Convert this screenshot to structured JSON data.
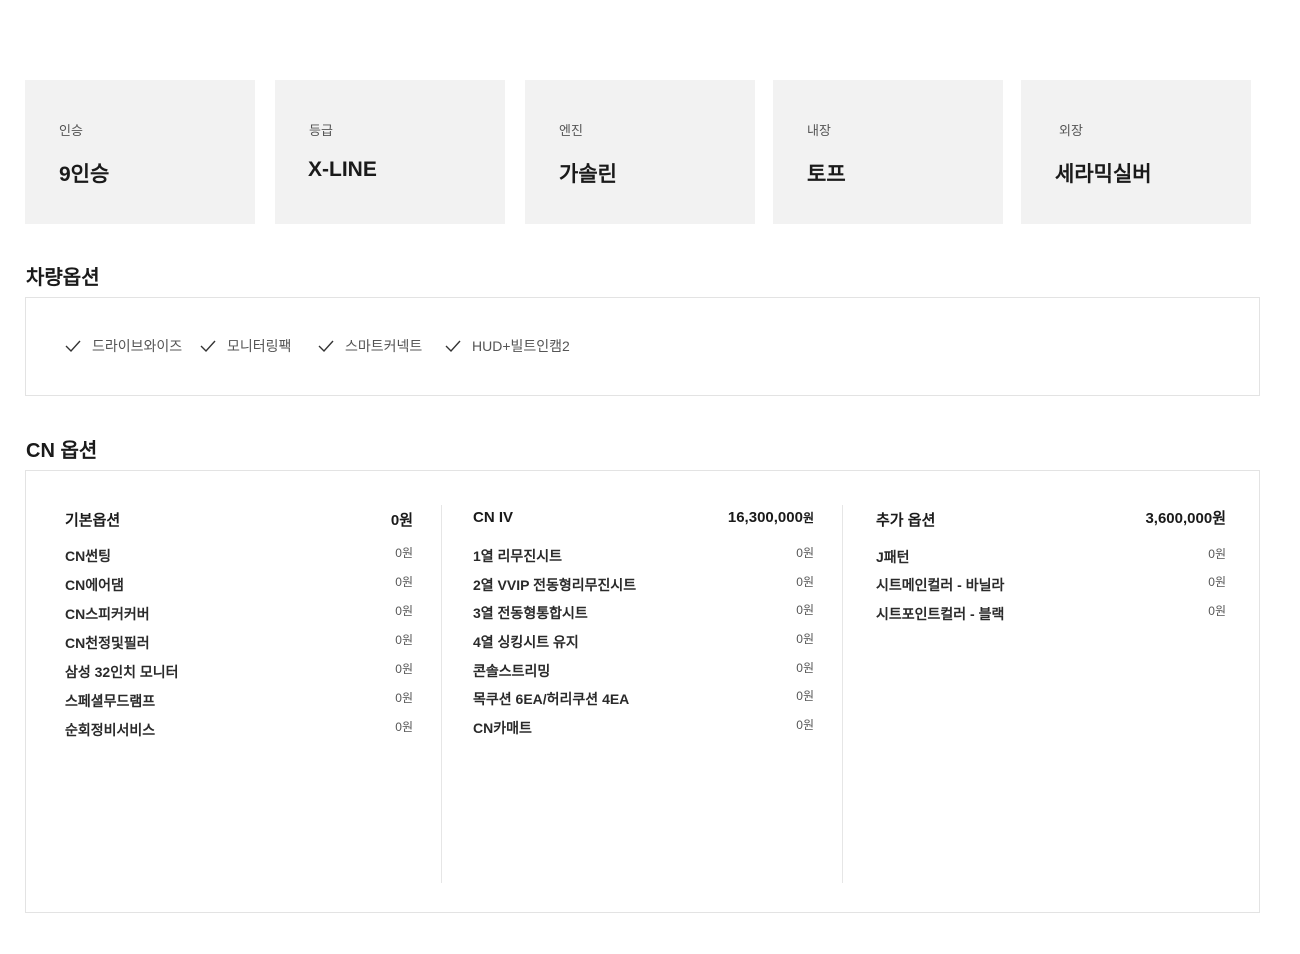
{
  "specs": [
    {
      "label": "인승",
      "value": "9인승"
    },
    {
      "label": "등급",
      "value": "X-LINE"
    },
    {
      "label": "엔진",
      "value": "가솔린"
    },
    {
      "label": "내장",
      "value": "토프"
    },
    {
      "label": "외장",
      "value": "세라믹실버"
    }
  ],
  "vehicle_options": {
    "title": "차량옵션",
    "items": [
      "드라이브와이즈",
      "모니터링팩",
      "스마트커넥트",
      "HUD+빌트인캠2"
    ]
  },
  "cn_options": {
    "title": "CN 옵션",
    "columns": [
      {
        "name": "기본옵션",
        "price": "0",
        "currency": "원",
        "rows": [
          {
            "name": "CN썬팅",
            "price": "0원"
          },
          {
            "name": "CN에어댐",
            "price": "0원"
          },
          {
            "name": "CN스피커커버",
            "price": "0원"
          },
          {
            "name": "CN천정및필러",
            "price": "0원"
          },
          {
            "name": "삼성 32인치 모니터",
            "price": "0원"
          },
          {
            "name": "스페셜무드램프",
            "price": "0원"
          },
          {
            "name": "순회정비서비스",
            "price": "0원"
          }
        ]
      },
      {
        "name": "CN IV",
        "price": "16,300,000",
        "currency": "원",
        "rows": [
          {
            "name": "1열 리무진시트",
            "price": "0원"
          },
          {
            "name": "2열 VVIP 전동형리무진시트",
            "price": "0원"
          },
          {
            "name": "3열 전동형통합시트",
            "price": "0원"
          },
          {
            "name": "4열 싱킹시트 유지",
            "price": "0원"
          },
          {
            "name": "콘솔스트리밍",
            "price": "0원"
          },
          {
            "name": "목쿠션 6EA/허리쿠션 4EA",
            "price": "0원"
          },
          {
            "name": "CN카매트",
            "price": "0원"
          }
        ]
      },
      {
        "name": "추가 옵션",
        "price": "3,600,000",
        "currency": "원",
        "rows": [
          {
            "name": "J패턴",
            "price": "0원"
          },
          {
            "name": "시트메인컬러 - 바닐라",
            "price": "0원"
          },
          {
            "name": "시트포인트컬러 - 블랙",
            "price": "0원"
          }
        ]
      }
    ]
  }
}
